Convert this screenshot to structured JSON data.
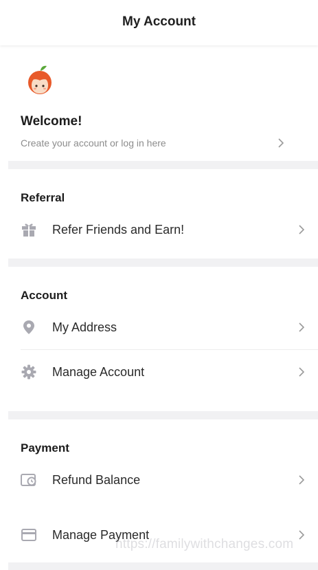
{
  "header": {
    "title": "My Account"
  },
  "profile": {
    "welcome": "Welcome!",
    "subtitle": "Create your account or log in here"
  },
  "referral": {
    "title": "Referral",
    "items": [
      {
        "label": "Refer Friends and Earn!",
        "icon": "gift-icon"
      }
    ]
  },
  "account": {
    "title": "Account",
    "items": [
      {
        "label": "My Address",
        "icon": "location-pin-icon"
      },
      {
        "label": "Manage Account",
        "icon": "gear-icon"
      }
    ]
  },
  "payment": {
    "title": "Payment",
    "items": [
      {
        "label": "Refund Balance",
        "icon": "wallet-icon"
      },
      {
        "label": "Manage Payment",
        "icon": "card-icon"
      }
    ]
  },
  "watermark": "https://familywithchanges.com",
  "colors": {
    "icon": "#a9a9b1",
    "chevron": "#9a9a9a",
    "section_gap": "#f1f1f3",
    "avatar_hair": "#e85a2a",
    "avatar_leaf": "#5aa83a"
  }
}
